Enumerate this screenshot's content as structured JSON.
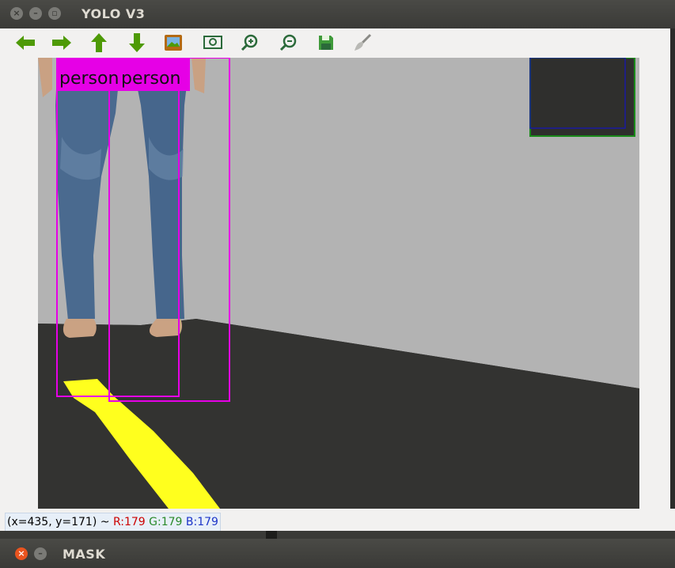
{
  "window": {
    "title": "YOLO V3"
  },
  "window2": {
    "title": "MASK"
  },
  "toolbar": {
    "buttons": [
      {
        "name": "pan-left",
        "icon": "arrow-left-icon"
      },
      {
        "name": "pan-right",
        "icon": "arrow-right-icon"
      },
      {
        "name": "pan-up",
        "icon": "arrow-up-icon"
      },
      {
        "name": "pan-down",
        "icon": "arrow-down-icon"
      },
      {
        "name": "image-view",
        "icon": "image-icon"
      },
      {
        "name": "zoom-fit",
        "icon": "zoom-fit-icon"
      },
      {
        "name": "zoom-in",
        "icon": "zoom-in-icon"
      },
      {
        "name": "zoom-out",
        "icon": "zoom-out-icon"
      },
      {
        "name": "save",
        "icon": "save-icon"
      },
      {
        "name": "properties",
        "icon": "brush-icon"
      }
    ]
  },
  "detections": [
    {
      "label": "person"
    },
    {
      "label": "person"
    }
  ],
  "status": {
    "coords": "(x=435, y=171) ~ ",
    "r": "R:179",
    "g": "G:179",
    "b": "B:179"
  },
  "colors": {
    "box": "#e600e6",
    "wall": "#b3b3b3",
    "floor": "#333331",
    "lane": "#ffff1e",
    "titlebar": "#3c3b37"
  }
}
